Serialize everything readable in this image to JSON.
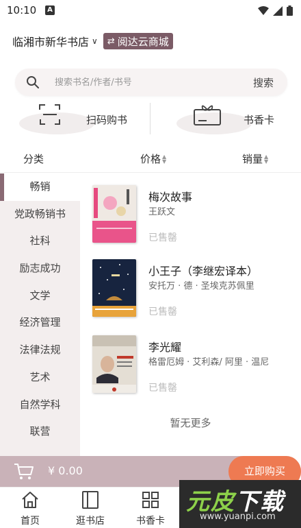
{
  "status_bar": {
    "time": "10:10",
    "notification_letter": "A"
  },
  "header": {
    "store_name": "临湘市新华书店",
    "switch_label": "阅达云商城"
  },
  "search": {
    "placeholder": "搜索书名/作者/书号",
    "button_label": "搜索"
  },
  "quick_actions": [
    {
      "label": "扫码购书",
      "icon": "scan-icon"
    },
    {
      "label": "书香卡",
      "icon": "gift-card-icon"
    }
  ],
  "sort_bar": {
    "category": "分类",
    "price": "价格",
    "sales": "销量"
  },
  "sidebar": {
    "items": [
      {
        "label": "畅销",
        "active": true
      },
      {
        "label": "党政畅销书"
      },
      {
        "label": "社科"
      },
      {
        "label": "励志成功"
      },
      {
        "label": "文学"
      },
      {
        "label": "经济管理"
      },
      {
        "label": "法律法规"
      },
      {
        "label": "艺术"
      },
      {
        "label": "自然学科"
      },
      {
        "label": "联营"
      }
    ]
  },
  "books": [
    {
      "title": "梅次故事",
      "author": "王跃文",
      "status": "已售罄",
      "cover_color": "#e8e2dc"
    },
    {
      "title": "小王子（李继宏译本）",
      "author": "安托万 · 德 · 圣埃克苏佩里",
      "status": "已售罄",
      "cover_color": "#1c2c4a"
    },
    {
      "title": "李光耀",
      "author": "格雷厄姆 · 艾利森/ 阿里 · 温尼",
      "status": "已售罄",
      "cover_color": "#d9d2c6"
    }
  ],
  "no_more_text": "暂无更多",
  "cart": {
    "total": "¥ 0.00",
    "buy_label": "立即购买"
  },
  "bottom_nav": [
    {
      "label": "首页",
      "icon": "home-icon"
    },
    {
      "label": "逛书店",
      "icon": "bookstore-icon"
    },
    {
      "label": "书香卡",
      "icon": "card-icon"
    }
  ],
  "watermark": {
    "text": "元皮下载",
    "url": "www.yuanpi.com"
  },
  "colors": {
    "accent": "#7b5b66",
    "buy": "#ee7a52",
    "cart_bar": "#c9b2b8",
    "sidebar_bg": "#f3eeee"
  }
}
